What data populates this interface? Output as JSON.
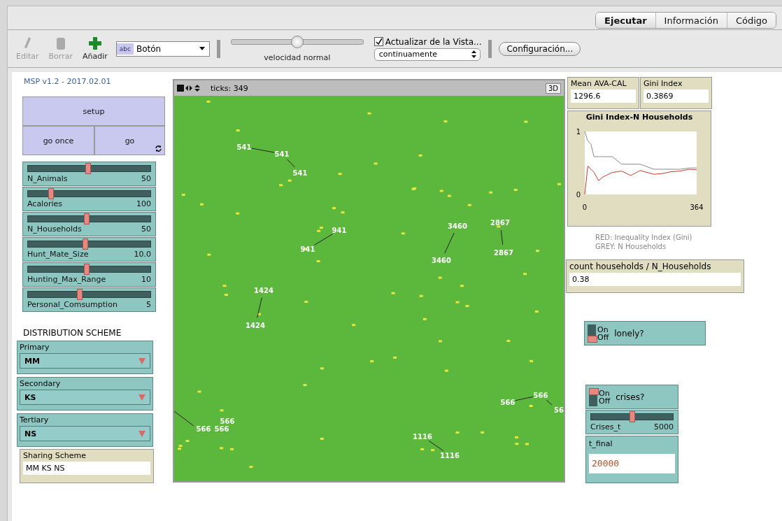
{
  "tabs": [
    {
      "label": "Ejecutar",
      "selected": true
    },
    {
      "label": "Información",
      "selected": false
    },
    {
      "label": "Código",
      "selected": false
    }
  ],
  "toolbar": {
    "tools": [
      {
        "label": "Editar",
        "disabled": true,
        "kind": "edit"
      },
      {
        "label": "Borrar",
        "disabled": true,
        "kind": "delete"
      },
      {
        "label": "Añadir",
        "disabled": false,
        "kind": "add"
      }
    ],
    "widget_type": {
      "value": "Botón",
      "badge": "abc"
    },
    "speed": {
      "level": 0.5,
      "label": "velocidad normal"
    },
    "view_updates": {
      "label": "Actualizar de la Vista...",
      "checked": true,
      "mode": "continuamente"
    },
    "settings_button": "Configuración..."
  },
  "interface": {
    "note": "MSP v1.2 - 2017.02.01",
    "buttons": [
      {
        "label": "setup",
        "forever": false
      },
      {
        "label": "go once",
        "forever": false
      },
      {
        "label": "go",
        "forever": true
      }
    ],
    "sliders": [
      {
        "name": "N_Animals",
        "value": "50",
        "level": 0.49
      },
      {
        "name": "Acalories",
        "value": "100",
        "level": 0.19
      },
      {
        "name": "N_Households",
        "value": "50",
        "level": 0.48
      },
      {
        "name": "Hunt_Mate_Size",
        "value": "10.0",
        "level": 0.47
      },
      {
        "name": "Hunting_Max_Range",
        "value": "10",
        "level": 0.48
      },
      {
        "name": "Personal_Comsumption",
        "value": "5",
        "level": 0.42
      }
    ],
    "section_title": "DISTRIBUTION SCHEME",
    "choosers": [
      {
        "label": "Primary",
        "value": "MM"
      },
      {
        "label": "Secondary",
        "value": "KS"
      },
      {
        "label": "Tertiary",
        "value": "NS"
      }
    ],
    "sharing_monitor": {
      "label": "Sharing Scheme",
      "value": "MM KS NS"
    },
    "view": {
      "ticks": "ticks: 349",
      "button_3d": "3D",
      "turtle_labels": [
        "541",
        "541",
        "541",
        "941",
        "941",
        "3460",
        "3460",
        "2867",
        "2867",
        "1424",
        "1424",
        "566",
        "566",
        "56",
        "566",
        "566",
        "566",
        "1116",
        "1116"
      ]
    },
    "monitors": [
      {
        "label": "Mean AVA-CAL",
        "value": "1296.6"
      },
      {
        "label": "Gini Index",
        "value": "0.3869"
      }
    ],
    "plot": {
      "chart_data": {
        "type": "line",
        "title": "Gini Index-N Households",
        "x": [
          0,
          10,
          20,
          30,
          45,
          60,
          90,
          120,
          150,
          180,
          225,
          250,
          280,
          310,
          340,
          364
        ],
        "xlim": [
          0,
          364
        ],
        "ylim": [
          0,
          1
        ],
        "xticks": [
          0,
          364
        ],
        "yticks": [
          0,
          1
        ],
        "series": [
          {
            "name": "GREY: N Households",
            "color": "#8a8a8a",
            "values": [
              1,
              0.85,
              0.8,
              0.6,
              0.6,
              0.6,
              0.6,
              0.48,
              0.48,
              0.48,
              0.4,
              0.4,
              0.4,
              0.4,
              0.42,
              0.42
            ]
          },
          {
            "name": "RED: Inequality Index (Gini)",
            "color": "#d03a2a",
            "values": [
              0,
              0.45,
              0.4,
              0.35,
              0.22,
              0.28,
              0.35,
              0.37,
              0.3,
              0.38,
              0.32,
              0.33,
              0.36,
              0.37,
              0.4,
              0.39
            ]
          }
        ]
      }
    },
    "count_monitor": {
      "label": "count households / N_Households",
      "value": "0.38"
    },
    "switches": [
      {
        "label": "lonely?",
        "on": false,
        "on_text": "On",
        "off_text": "Off"
      },
      {
        "label": "crises?",
        "on": true,
        "on_text": "On",
        "off_text": "Off"
      }
    ],
    "crises_slider": {
      "name": "Crises_t",
      "value": "5000",
      "level": 0.5
    },
    "input": {
      "label": "t_final",
      "value": "20000"
    }
  }
}
